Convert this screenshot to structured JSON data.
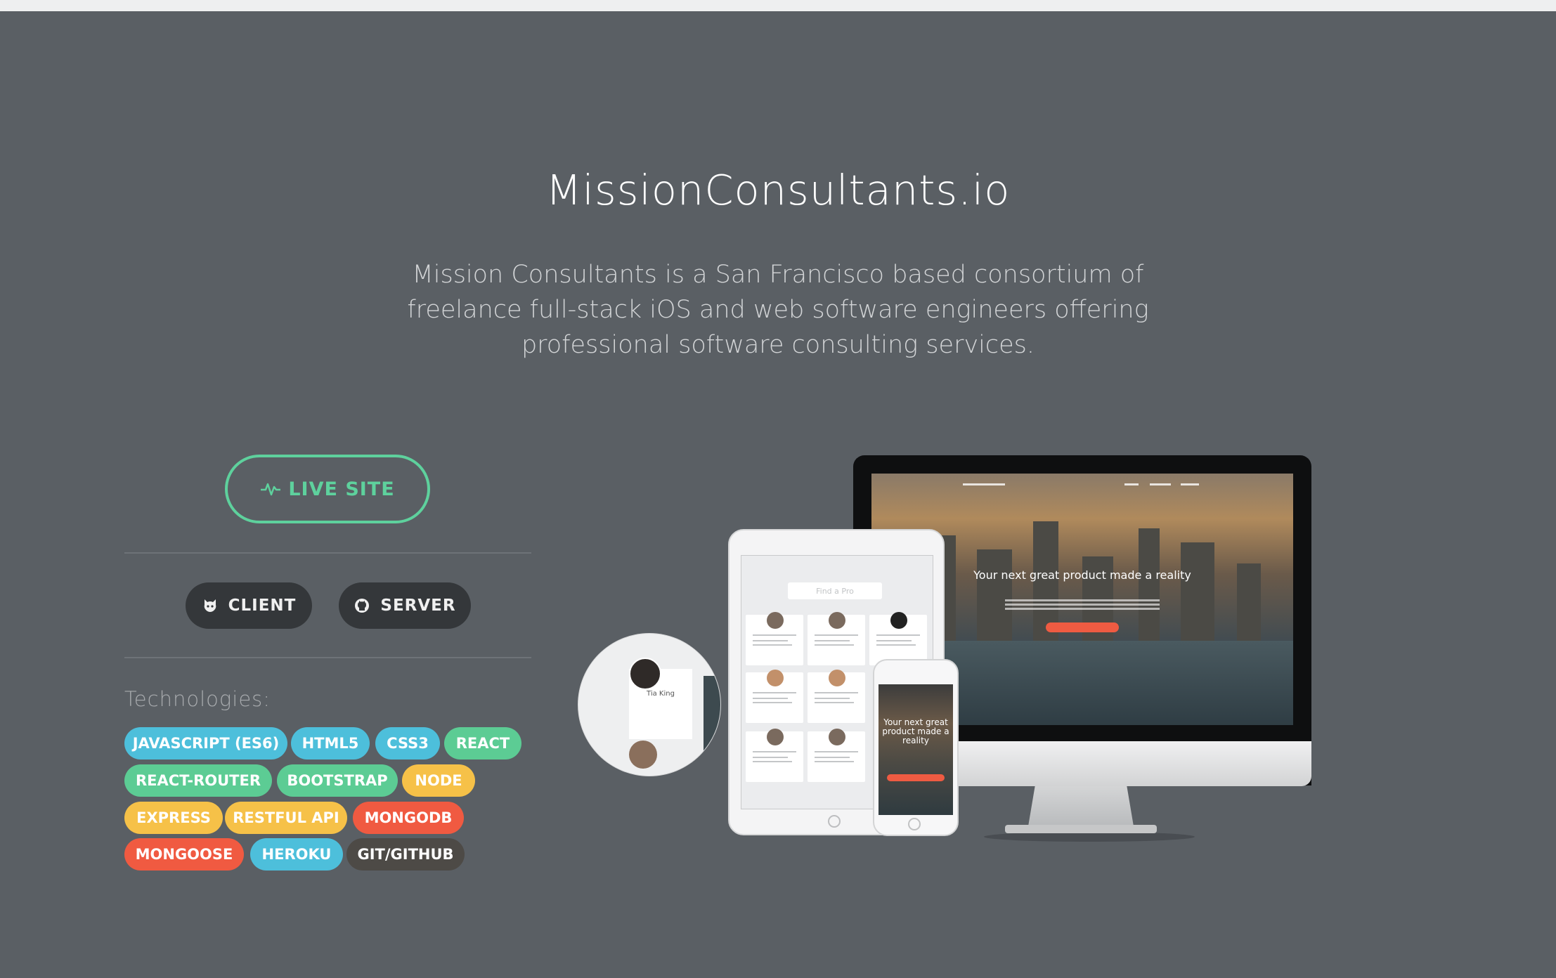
{
  "project": {
    "title": "MissionConsultants.io",
    "description": "Mission Consultants is a San Francisco based consortium of freelance full-stack iOS and web software engineers offering professional software consulting services."
  },
  "actions": {
    "live_site": "LIVE SITE",
    "client": "CLIENT",
    "server": "SERVER"
  },
  "technologies": {
    "label": "Technologies:",
    "tags": [
      {
        "name": "JAVASCRIPT (ES6)",
        "color": "#4dbfdb"
      },
      {
        "name": "HTML5",
        "color": "#4dbfdb"
      },
      {
        "name": "CSS3",
        "color": "#4dbfdb"
      },
      {
        "name": "REACT",
        "color": "#5ccc94"
      },
      {
        "name": "REACT-ROUTER",
        "color": "#5ccc94"
      },
      {
        "name": "BOOTSTRAP",
        "color": "#5ccc94"
      },
      {
        "name": "NODE",
        "color": "#f6c148"
      },
      {
        "name": "EXPRESS",
        "color": "#f6c148"
      },
      {
        "name": "RESTFUL API",
        "color": "#f6c148"
      },
      {
        "name": "MONGODB",
        "color": "#f05a41"
      },
      {
        "name": "MONGOOSE",
        "color": "#f05a41"
      },
      {
        "name": "HEROKU",
        "color": "#4dbfdb"
      },
      {
        "name": "GIT/GITHUB",
        "color": "#4d4a46"
      }
    ]
  },
  "mockup": {
    "desktop_headline": "Your next great product made a reality",
    "tablet_search_placeholder": "Find a Pro",
    "phone_headline": "Your next great product made a reality",
    "zoom_name": "Tia King"
  },
  "colors": {
    "background": "#5a5f64",
    "accent_green": "#5ed19d",
    "dark_button": "#34373a"
  }
}
